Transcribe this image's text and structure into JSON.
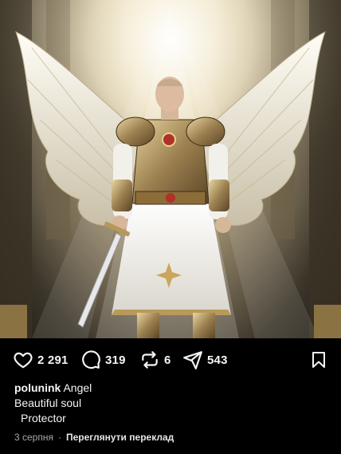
{
  "post": {
    "image_alt": "Angel warrior figure in golden armour with white wings",
    "likes": "2 291",
    "comments": "319",
    "reposts": "6",
    "shares": "543",
    "author": "polunink",
    "caption_first": "Angel",
    "caption_lines": [
      "Beautiful soul",
      "Protector"
    ],
    "date": "3 серпня",
    "separator": "·",
    "translate_label": "Переглянути переклад"
  },
  "icons": {
    "like": "heart-icon",
    "comment": "comment-bubble-icon",
    "repost": "repost-arrows-icon",
    "share": "paper-plane-icon",
    "save": "bookmark-icon"
  }
}
